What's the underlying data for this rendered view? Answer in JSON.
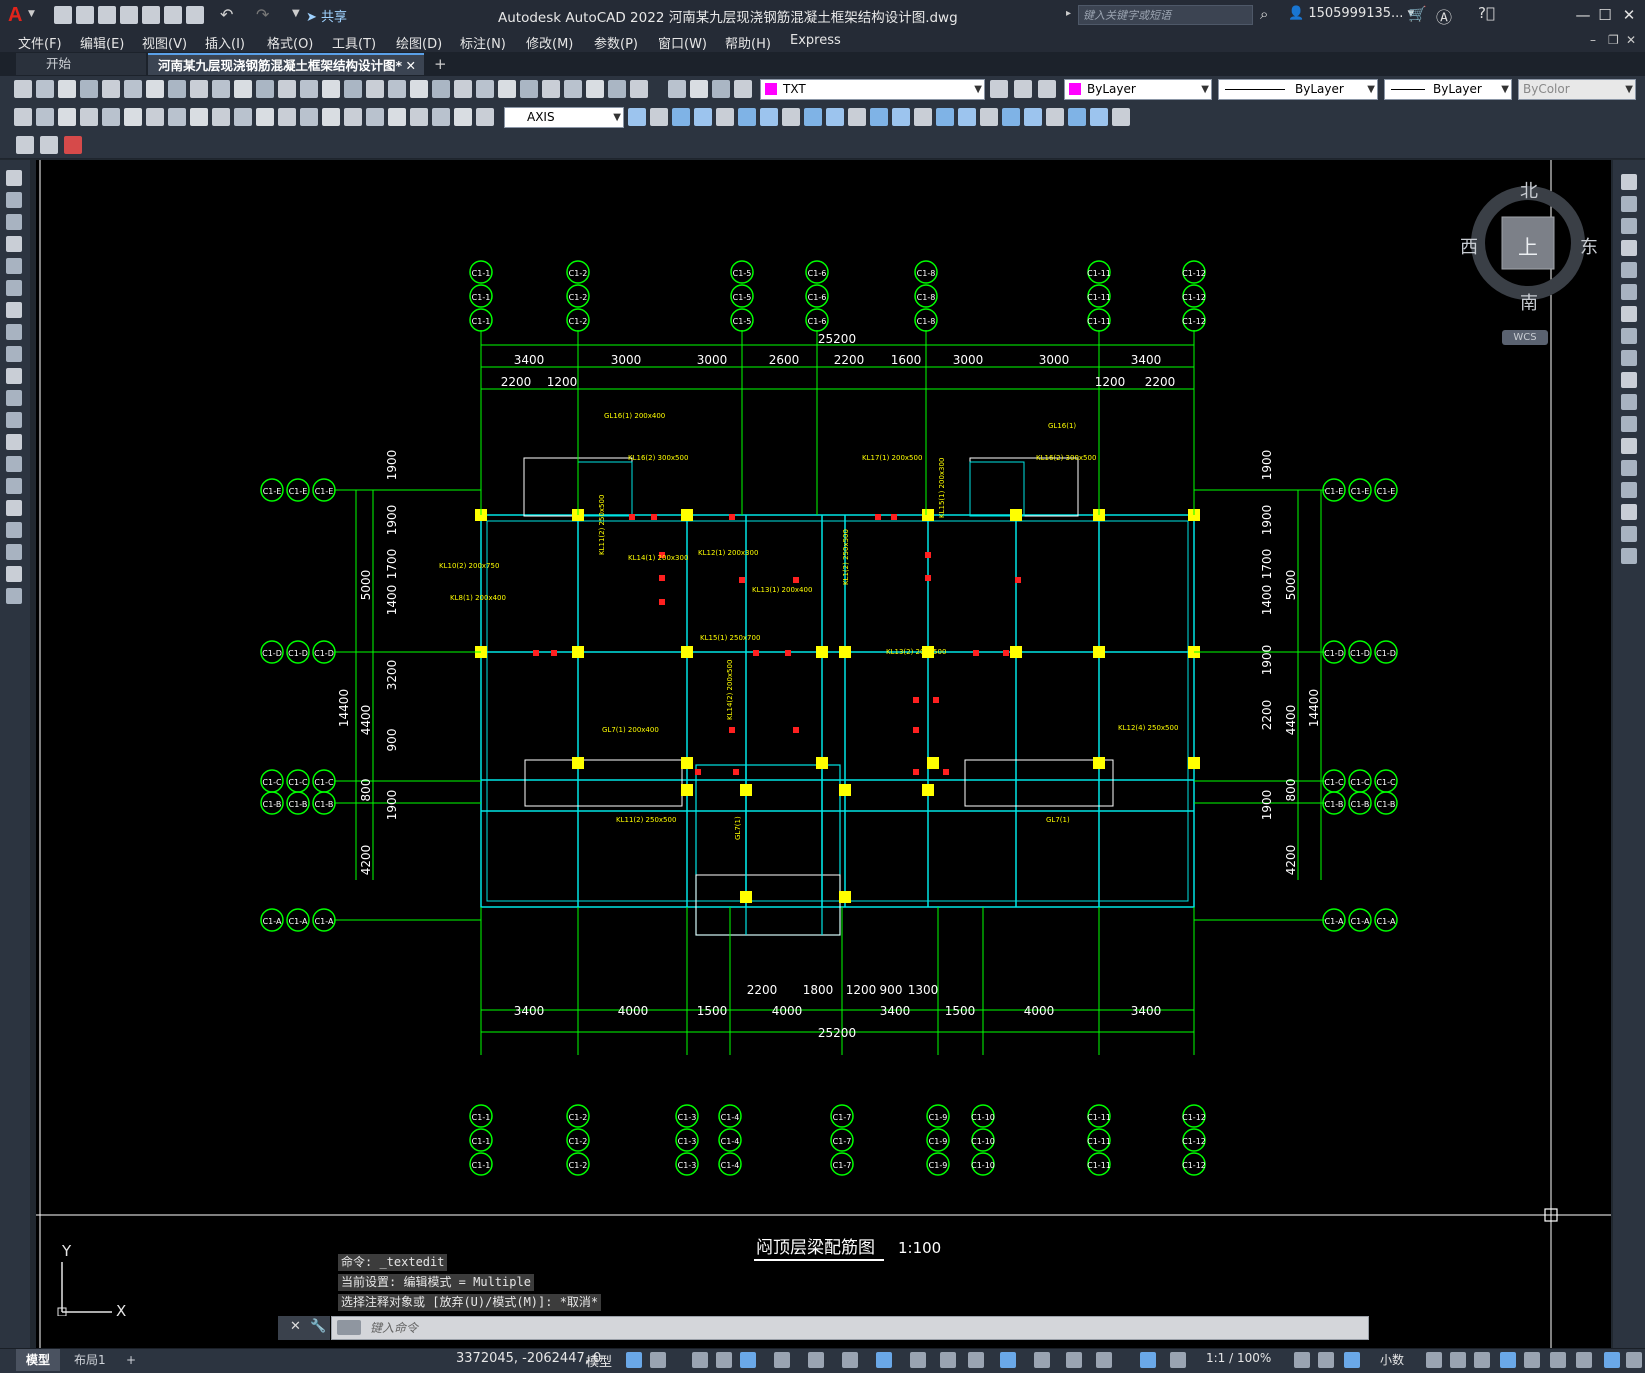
{
  "app": {
    "logo": "A",
    "window_title": "Autodesk AutoCAD 2022    河南某九层现浇钢筋混凝土框架结构设计图.dwg",
    "share_label": "共享",
    "search_placeholder": "键入关键字或短语",
    "user": "1505999135...",
    "accent": "#e2241b"
  },
  "menu": [
    "文件(F)",
    "编辑(E)",
    "视图(V)",
    "插入(I)",
    "格式(O)",
    "工具(T)",
    "绘图(D)",
    "标注(N)",
    "修改(M)",
    "参数(P)",
    "窗口(W)",
    "帮助(H)",
    "Express"
  ],
  "tabs": {
    "start": "开始",
    "active": "河南某九层现浇钢筋混凝土框架结构设计图*",
    "add": "+"
  },
  "toolbar": {
    "textstyle": "TXT",
    "layer_color": "ByLayer",
    "linetype": "ByLayer",
    "lineweight": "ByLayer",
    "plotstyle": "ByColor",
    "dimstyle": "AXIS"
  },
  "viewcube": {
    "north": "北",
    "south": "南",
    "east": "东",
    "west": "西",
    "top": "上",
    "wcs": "WCS"
  },
  "drawing": {
    "top_overall": "25200",
    "top_dims": [
      "3400",
      "3000",
      "3000",
      "2600",
      "2200",
      "1600",
      "3000",
      "3000",
      "3400"
    ],
    "top_dims2": [
      "2200",
      "1200",
      "1200",
      "2200"
    ],
    "bottom_overall": "25200",
    "bottom_dims": [
      "3400",
      "4000",
      "1500",
      "4000",
      "3400",
      "1500",
      "4000",
      "3400"
    ],
    "bottom_dims2": [
      "2200",
      "1800",
      "1200",
      "900",
      "1300"
    ],
    "left_total": "14400",
    "left_dims": [
      "5000",
      "4400",
      "800",
      "4200"
    ],
    "left_dims2": [
      "1900",
      "1900",
      "1700",
      "1400",
      "3200",
      "900",
      "1900"
    ],
    "right_total": "14400",
    "right_dims": [
      "5000",
      "4400",
      "800",
      "4200"
    ],
    "right_dims2": [
      "1900",
      "1900",
      "1700",
      "1400",
      "1900",
      "2200",
      "1900"
    ],
    "grid_top": [
      "C1-1",
      "C1-2",
      "C1-5",
      "C1-6",
      "C1-8",
      "C1-11",
      "C1-12"
    ],
    "grid_bottom": [
      "C1-1",
      "C1-2",
      "C1-3",
      "C1-4",
      "C1-7",
      "C1-9",
      "C1-10",
      "C1-11",
      "C1-12"
    ],
    "grid_left": [
      "C1-E",
      "C1-D",
      "C1-C",
      "C1-B",
      "C1-A"
    ],
    "grid_right": [
      "C1-E",
      "C1-D",
      "C1-C",
      "C1-B",
      "C1-A"
    ],
    "drawing_title": "闷顶层梁配筋图",
    "scale": "1:100",
    "beam_labels": [
      "GL16(1) 200x400",
      "KL16(2) 300x500",
      "KL17(1) 200x500",
      "KL15(1) 200x300",
      "GL16(1)",
      "KL16(2) 300x500",
      "KL10(2) 200x750",
      "KL11(2) 250x500",
      "KL14(1) 200x300",
      "KL12(1) 200x300",
      "KL13(1) 200x400",
      "KL1(2) 250x500",
      "KL15(1) 250x700",
      "KL8(1) 200x400",
      "KL13(2) 200x500",
      "KL14(2) 200x500",
      "GL7(1) 200x400",
      "KL12(4) 250x500",
      "KL11(2) 250x500",
      "GL7(1)",
      "GL7(1)"
    ]
  },
  "command": {
    "history": [
      "命令: _textedit",
      "当前设置: 编辑模式 = Multiple",
      "选择注释对象或 [放弃(U)/模式(M)]: *取消*"
    ],
    "placeholder": "键入命令"
  },
  "status": {
    "tabs": [
      "模型",
      "布局1",
      "+"
    ],
    "coords": "3372045, -2062447, 0",
    "model": "模型",
    "scale": "1:1 / 100%",
    "units": "小数"
  }
}
